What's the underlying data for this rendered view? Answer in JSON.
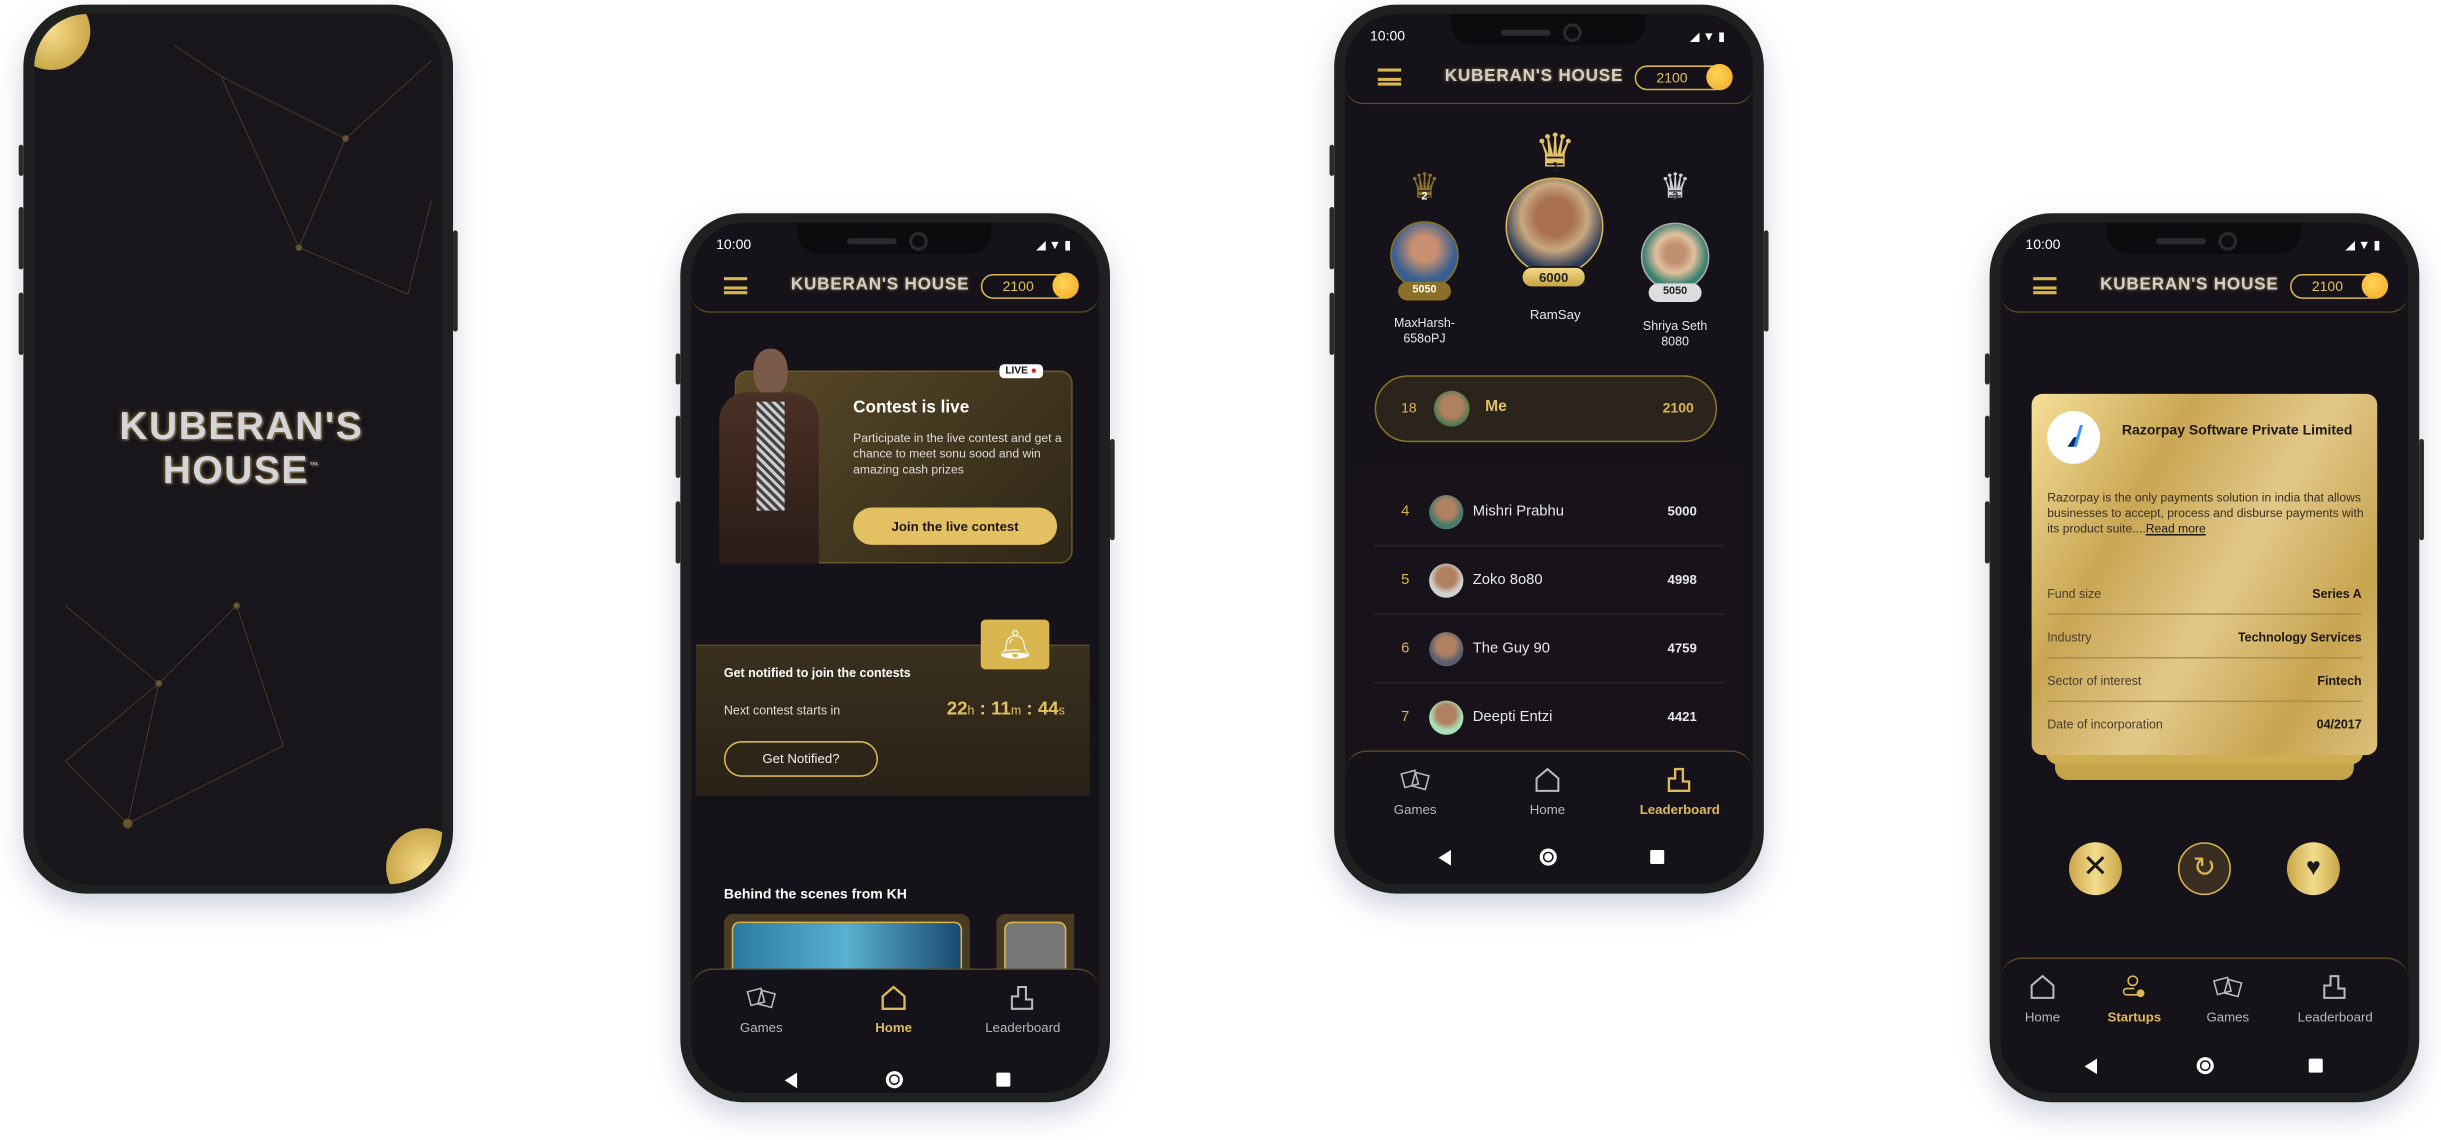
{
  "colors": {
    "gold": "#d9b650",
    "background": "#16121a",
    "card": "#4a3c22",
    "live_dot": "#e02020"
  },
  "status_time": "10:00",
  "header": {
    "logo": "KUBERAN'S HOUSE",
    "coins": "2100",
    "menu_icon": "hamburger-icon",
    "coin_icon": "rupee-coin-icon"
  },
  "splash": {
    "logo": "KUBERAN'S HOUSE",
    "tm": "™"
  },
  "home": {
    "live_badge": "LIVE",
    "contest_title": "Contest is live",
    "contest_desc": "Participate in the live contest and get a chance to meet sonu sood and win amazing cash prizes",
    "join_button": "Join the live contest",
    "notify_title": "Get notified to join the contests",
    "next_label": "Next contest starts in",
    "countdown": {
      "h": "22",
      "h_unit": "h",
      "m": "11",
      "m_unit": "m",
      "s": "44",
      "s_unit": "s"
    },
    "notify_button": "Get Notified?",
    "behind_title": "Behind the scenes from KH",
    "nav": [
      {
        "label": "Games",
        "icon": "dice-icon"
      },
      {
        "label": "Home",
        "icon": "home-icon",
        "active": true
      },
      {
        "label": "Leaderboard",
        "icon": "leaderboard-icon"
      }
    ]
  },
  "leaderboard": {
    "podium": [
      {
        "rank": "2",
        "name": "MaxHarsh-6580PJ",
        "name_l1": "MaxHarsh-",
        "name_l2": "658oPJ",
        "score": "5050"
      },
      {
        "rank": "1",
        "name": "RamSay",
        "score": "6000"
      },
      {
        "rank": "3",
        "name": "Shriya Seth 8080",
        "name_l1": "Shriya Seth",
        "name_l2": "8080",
        "score": "5050"
      }
    ],
    "me": {
      "rank": "18",
      "name": "Me",
      "score": "2100"
    },
    "rows": [
      {
        "rank": "4",
        "name": "Mishri Prabhu",
        "score": "5000"
      },
      {
        "rank": "5",
        "name": "Zoko 8o80",
        "score": "4998"
      },
      {
        "rank": "6",
        "name": "The Guy 90",
        "score": "4759"
      },
      {
        "rank": "7",
        "name": "Deepti Entzi",
        "score": "4421"
      }
    ],
    "nav": [
      {
        "label": "Games",
        "icon": "dice-icon"
      },
      {
        "label": "Home",
        "icon": "home-icon"
      },
      {
        "label": "Leaderboard",
        "icon": "leaderboard-icon",
        "active": true
      }
    ]
  },
  "startup": {
    "company": "Razorpay Software Private Limited",
    "description": "Razorpay is the only payments solution in india that allows businesses to accept, process and disburse payments with its product suite....",
    "read_more": "Read more",
    "fields": [
      {
        "label": "Fund size",
        "value": "Series A"
      },
      {
        "label": "Industry",
        "value": "Technology Services"
      },
      {
        "label": "Sector of interest",
        "value": "Fintech"
      },
      {
        "label": "Date of incorporation",
        "value": "04/2017"
      }
    ],
    "actions": [
      "close-icon",
      "refresh-icon",
      "heart-icon"
    ],
    "nav": [
      {
        "label": "Home",
        "icon": "home-icon"
      },
      {
        "label": "Startups",
        "icon": "startups-icon",
        "active": true
      },
      {
        "label": "Games",
        "icon": "dice-icon"
      },
      {
        "label": "Leaderboard",
        "icon": "leaderboard-icon"
      }
    ]
  }
}
